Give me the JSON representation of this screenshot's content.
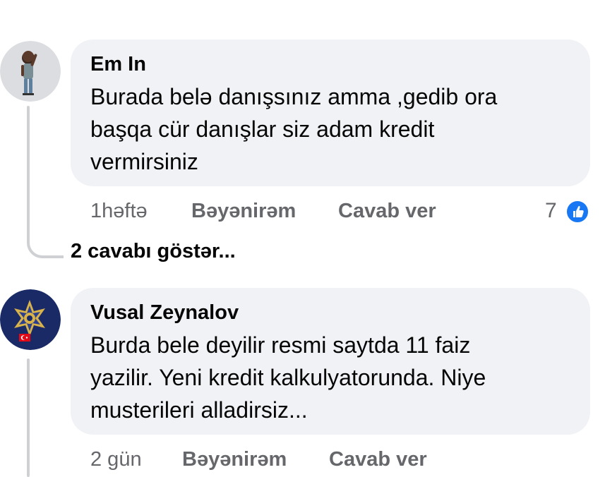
{
  "comments": [
    {
      "author": "Em In",
      "text": "Burada belə danışsınız amma ,gedib ora başqa cür danışlar siz adam kredit vermirsiniz",
      "text_lines": [
        "Burada belə danışsınız amma ,gedib ora",
        "başqa cür danışlar siz adam kredit",
        "vermirsiniz"
      ],
      "time": "1həftə",
      "like_label": "Bəyənirəm",
      "reply_label": "Cavab ver",
      "reaction_count": "7",
      "reaction_icon": "like-icon",
      "show_replies": "2 cavabı göstər..."
    },
    {
      "author": "Vusal Zeynalov",
      "text": "Burda bele deyilir resmi saytda 11 faiz yazilir. Yeni kredit kalkulyatorunda. Niye musterileri alladirsiz...",
      "text_lines": [
        "Burda bele deyilir resmi saytda 11 faiz",
        "yazilir. Yeni kredit kalkulyatorunda. Niye",
        "musterileri alladirsiz..."
      ],
      "time": "2 gün",
      "like_label": "Bəyənirəm",
      "reply_label": "Cavab ver"
    }
  ],
  "colors": {
    "bubble": "#f0f2f5",
    "meta_text": "#65676b",
    "like_blue": "#1877f2",
    "thread_line": "#ced0d4"
  }
}
